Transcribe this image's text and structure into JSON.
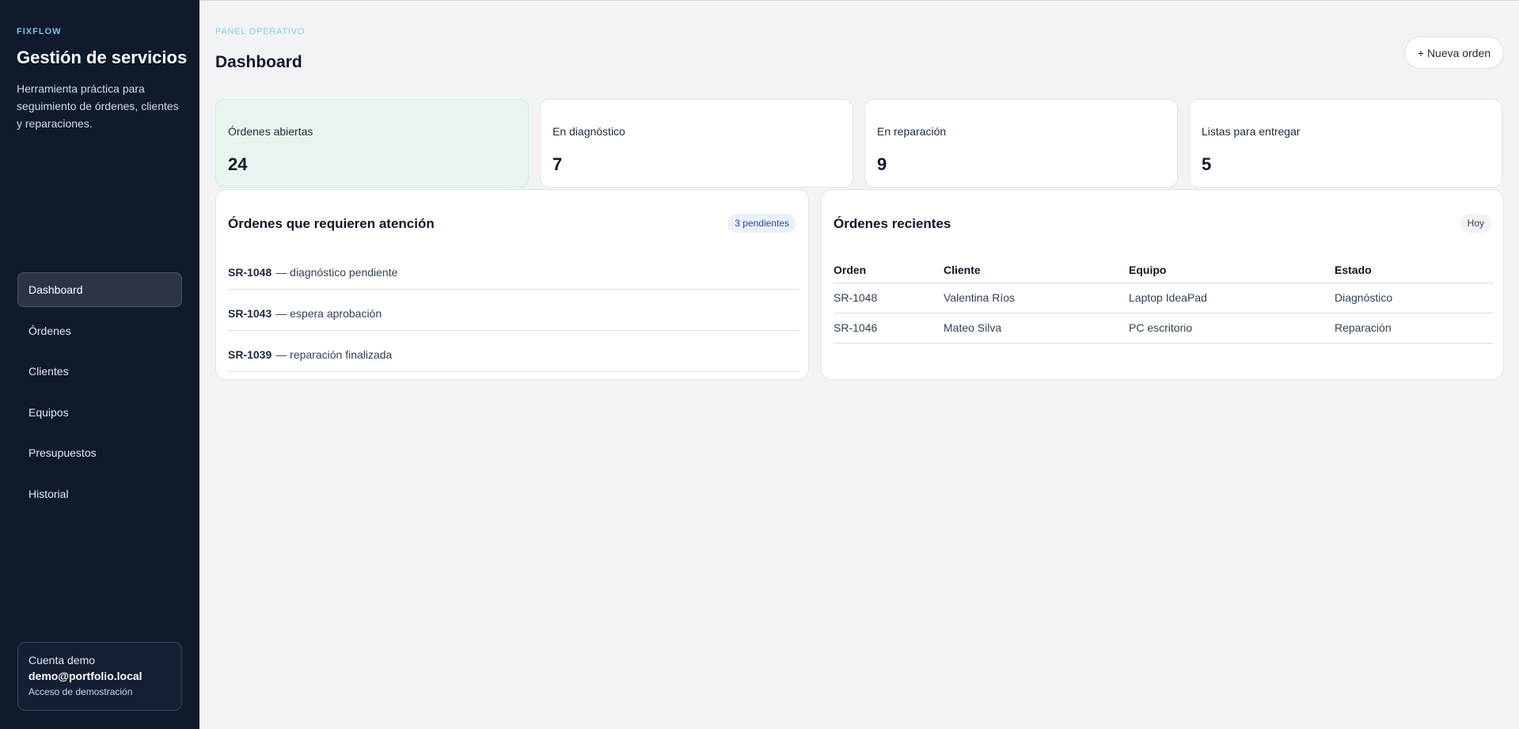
{
  "sidebar": {
    "brand_kicker": "FIXFLOW",
    "title": "Gestión de servicios",
    "description": "Herramienta práctica para seguimiento de órdenes, clientes y reparaciones.",
    "nav": [
      "Dashboard",
      "Órdenes",
      "Clientes",
      "Equipos",
      "Presupuestos",
      "Historial"
    ],
    "active_nav": "Dashboard",
    "account": {
      "label": "Cuenta demo",
      "email": "demo@portfolio.local",
      "note": "Acceso de demostración"
    }
  },
  "header": {
    "kicker": "PANEL OPERATIVO",
    "title": "Dashboard",
    "new_order_label": "+ Nueva orden"
  },
  "stats": [
    {
      "label": "Órdenes abiertas",
      "value": "24"
    },
    {
      "label": "En diagnóstico",
      "value": "7"
    },
    {
      "label": "En reparación",
      "value": "9"
    },
    {
      "label": "Listas para entregar",
      "value": "5"
    }
  ],
  "attention": {
    "title": "Órdenes que requieren atención",
    "badge": "3 pendientes",
    "items": [
      {
        "code": "SR-1048",
        "text": "— diagnóstico pendiente"
      },
      {
        "code": "SR-1043",
        "text": "— espera aprobación"
      },
      {
        "code": "SR-1039",
        "text": "— reparación finalizada"
      }
    ]
  },
  "recent": {
    "title": "Órdenes recientes",
    "badge": "Hoy",
    "columns": [
      "Orden",
      "Cliente",
      "Equipo",
      "Estado"
    ],
    "rows": [
      [
        "SR-1048",
        "Valentina Ríos",
        "Laptop IdeaPad",
        "Diagnóstico"
      ],
      [
        "SR-1046",
        "Mateo Silva",
        "PC escritorio",
        "Reparación"
      ]
    ]
  },
  "colors": {
    "sidebar_bg": "#0f1a2c",
    "accent": "#7cc4ea",
    "highlight_card": "#e8f5ef"
  }
}
